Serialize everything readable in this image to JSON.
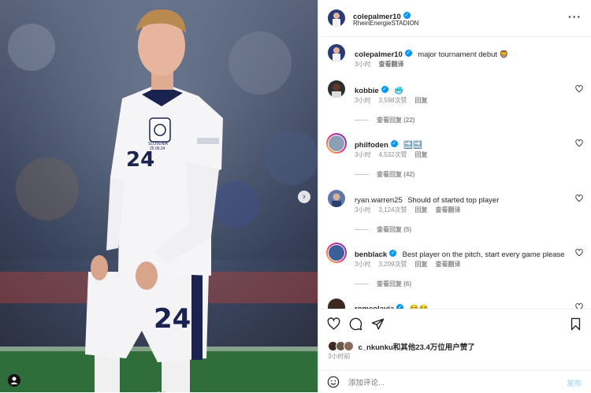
{
  "post": {
    "author": "colepalmer10",
    "location": "RheinEnergieSTADION",
    "caption_user": "colepalmer10",
    "caption_text": "major tournament debut 🦁",
    "caption_time": "3小时",
    "caption_translate": "查看翻译",
    "likes_text": "c_nkunku和其他23.4万位用户赞了",
    "post_time": "3小时前",
    "add_comment_placeholder": "添加评论...",
    "publish_label": "发布",
    "shirt_number": "24",
    "match_patch_line1": "SLOVENIA",
    "match_patch_line2": "25.06.24"
  },
  "comments": [
    {
      "user": "kobbie",
      "text": "🥶",
      "time": "3小时",
      "likes": "3,598次赞",
      "reply": "回复",
      "translate": "",
      "view_replies": "查看回复 (22)"
    },
    {
      "user": "philfoden",
      "text": "🔜🔜",
      "time": "3小时",
      "likes": "4,532次赞",
      "reply": "回复",
      "translate": "",
      "view_replies": "查看回复 (42)"
    },
    {
      "user": "ryan.warren25",
      "text": "Should of started top player",
      "time": "3小时",
      "likes": "3,124次赞",
      "reply": "回复",
      "translate": "查看翻译",
      "view_replies": "查看回复 (5)"
    },
    {
      "user": "benblack",
      "text": "Best player on the pitch, start every game please",
      "time": "3小时",
      "likes": "3,209次赞",
      "reply": "回复",
      "translate": "查看翻译",
      "view_replies": "查看回复 (6)"
    },
    {
      "user": "romeolavia",
      "text": "😂😂",
      "time": "",
      "likes": "",
      "reply": "",
      "translate": "",
      "view_replies": ""
    }
  ],
  "colors": {
    "accent": "#0095f6",
    "muted": "#8e8e8e",
    "text": "#262626"
  },
  "icons": [
    "more-icon",
    "heart-icon",
    "comment-icon",
    "share-icon",
    "bookmark-icon",
    "emoji-icon",
    "next-arrow-icon",
    "verified-icon",
    "profile-icon"
  ]
}
